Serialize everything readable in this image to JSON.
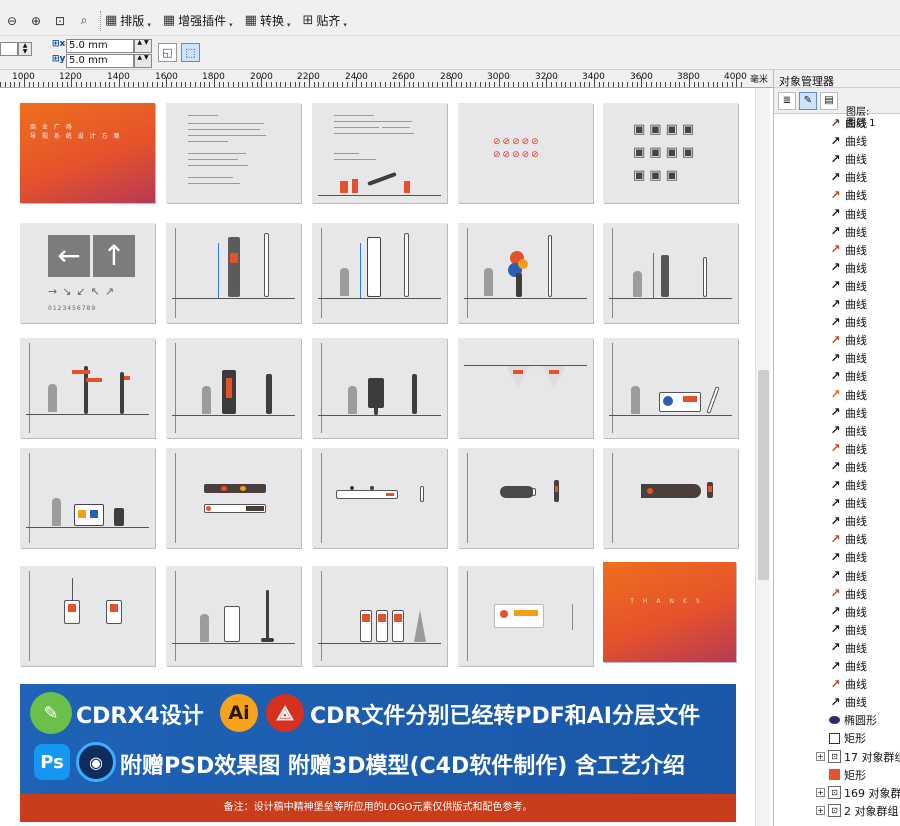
{
  "toolbar": {
    "buttons": [
      {
        "label": "排版"
      },
      {
        "label": "增强插件"
      },
      {
        "label": "转换"
      },
      {
        "label": "贴齐"
      }
    ]
  },
  "property_bar": {
    "x_value": "5.0 mm",
    "y_value": "5.0 mm"
  },
  "ruler": {
    "labels": [
      "1000",
      "1200",
      "1400",
      "1600",
      "1800",
      "2000",
      "2200",
      "2400",
      "2600",
      "2800",
      "3000",
      "3200",
      "3400",
      "3600",
      "3800",
      "4000"
    ],
    "unit": "毫米"
  },
  "pages": {
    "cover": {
      "line1": "商 业 广 场",
      "line2": "导 视 系 统 设 计 方 案"
    },
    "thanks": {
      "text": "THANKS"
    },
    "number_sample": "0123456789"
  },
  "banner": {
    "line1a": "CDRX4设计",
    "line1b": "CDR文件分别已经转PDF和AI分层文件",
    "line2": "附赠PSD效果图 附赠3D模型(C4D软件制作) 含工艺介绍",
    "ai_label": "Ai",
    "ps_label": "Ps",
    "note": "备注：设计稿中精神堡垒等所应用的LOGO元素仅供版式和配色参考。"
  },
  "object_manager": {
    "title": "对象管理器",
    "layer_label": "图层:",
    "layer_name": "图层 1",
    "curve_label": "曲线",
    "curve_count": 33,
    "items_after": [
      {
        "label": "椭圆形",
        "icon": "ellipse"
      },
      {
        "label": "矩形",
        "icon": "rect-white"
      },
      {
        "label": "17 对象群组",
        "icon": "group"
      },
      {
        "label": "矩形",
        "icon": "rect-orange"
      },
      {
        "label": "169 对象群组",
        "icon": "group"
      },
      {
        "label": "2 对象群组",
        "icon": "group"
      }
    ]
  },
  "colors": {
    "accent_orange": "#e6522b",
    "banner_blue": "#1e63b6",
    "note_red": "#c93d1b"
  }
}
